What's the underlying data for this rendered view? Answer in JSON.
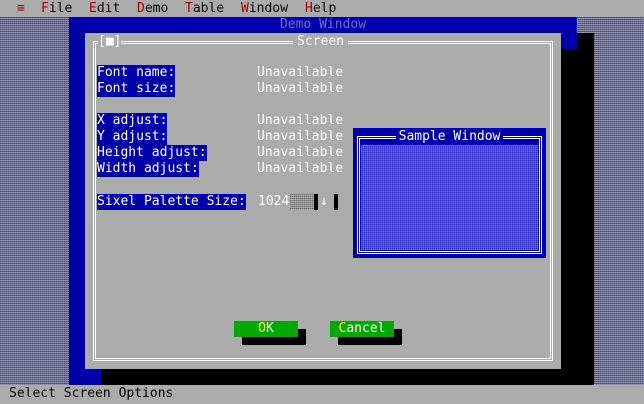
{
  "menubar": {
    "system_glyph": "≡",
    "items": [
      {
        "hot": "F",
        "rest": "ile"
      },
      {
        "hot": "E",
        "rest": "dit"
      },
      {
        "hot": "D",
        "rest": "emo"
      },
      {
        "hot": "T",
        "rest": "able"
      },
      {
        "hot": "W",
        "rest": "indow"
      },
      {
        "hot": "H",
        "rest": "elp"
      }
    ]
  },
  "demo_window": {
    "title": "Demo Window"
  },
  "dialog": {
    "title": "Screen",
    "close_box": "[■]",
    "fields": [
      {
        "label": "Font name:",
        "value": "Unavailable"
      },
      {
        "label": "Font size:",
        "value": "Unavailable"
      },
      {
        "label": "X adjust:",
        "value": "Unavailable"
      },
      {
        "label": "Y adjust:",
        "value": "Unavailable"
      },
      {
        "label": "Height adjust:",
        "value": "Unavailable"
      },
      {
        "label": "Width adjust:",
        "value": "Unavailable"
      }
    ],
    "palette": {
      "label": "Sixel Palette Size:",
      "value": "1024",
      "arrow": "↓"
    },
    "sample_window": {
      "title": "Sample Window"
    },
    "ok_button": {
      "hot": "O",
      "rest": "K"
    },
    "cancel_button": {
      "hot": "C",
      "rest": "ancel"
    }
  },
  "statusbar": {
    "text": "Select Screen Options"
  },
  "colors": {
    "menu_bg": "#ababab",
    "hotkey_red": "#a80000",
    "window_blue": "#0000a8",
    "dialog_gray": "#ababab",
    "button_green": "#00a800",
    "button_hotkey": "#ffff55"
  }
}
